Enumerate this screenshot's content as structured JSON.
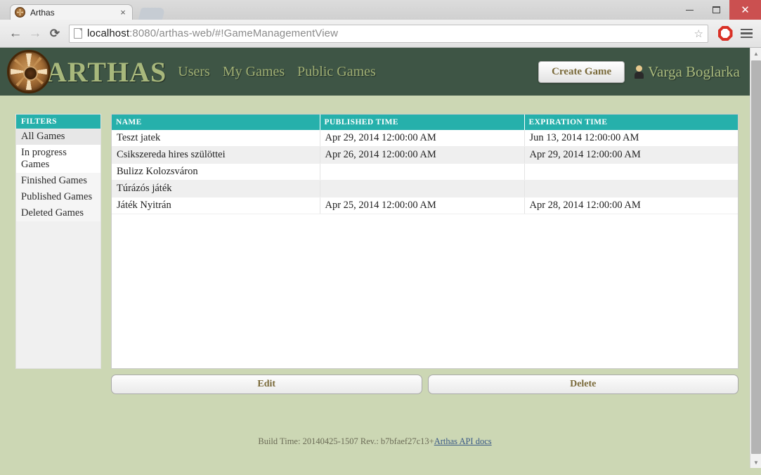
{
  "browser": {
    "tab": {
      "title": "Arthas",
      "favicon": "compass-favicon",
      "close": "×"
    },
    "nav": {
      "back": "←",
      "forward": "→",
      "reload": "⟳"
    },
    "url": {
      "protocol_host": "localhost",
      "rest": ":8080/arthas-web/#!GameManagementView"
    },
    "star": "☆",
    "stop_icon": "✋",
    "window": {
      "minimize": "minimize",
      "maximize": "maximize",
      "close": "✕"
    }
  },
  "header": {
    "logo": "compass-rose-logo",
    "brand": "ARTHAS",
    "nav_links": [
      {
        "label": "Users"
      },
      {
        "label": "My Games"
      },
      {
        "label": "Public Games"
      }
    ],
    "create_game_label": "Create Game",
    "user": {
      "avatar": "user-avatar-icon",
      "name": "Varga Boglarka"
    }
  },
  "filters": {
    "title": "FILTERS",
    "items": [
      {
        "label": "All Games",
        "active": true
      },
      {
        "label": "In progress Games",
        "active": false
      },
      {
        "label": "Finished Games",
        "active": false
      },
      {
        "label": "Published Games",
        "active": false
      },
      {
        "label": "Deleted Games",
        "active": false
      }
    ]
  },
  "table": {
    "columns": [
      "NAME",
      "PUBLISHED TIME",
      "EXPIRATION TIME"
    ],
    "rows": [
      [
        "Teszt jatek",
        "Apr 29, 2014 12:00:00 AM",
        "Jun 13, 2014 12:00:00 AM"
      ],
      [
        "Csikszereda hires szülöttei",
        "Apr 26, 2014 12:00:00 AM",
        "Apr 29, 2014 12:00:00 AM"
      ],
      [
        "Bulizz Kolozsváron",
        "",
        ""
      ],
      [
        "Túrázós játék",
        "",
        ""
      ],
      [
        "Játék Nyitrán",
        "Apr 25, 2014 12:00:00 AM",
        "Apr 28, 2014 12:00:00 AM"
      ]
    ]
  },
  "actions": {
    "edit_label": "Edit",
    "delete_label": "Delete"
  },
  "footer": {
    "build_text": "Build Time: 20140425-1507 Rev.: b7bfaef27c13+",
    "link_label": "Arthas API docs"
  },
  "colors": {
    "header_green": "#3e5545",
    "page_bg": "#ccd7b4",
    "accent_teal": "#26b0ab",
    "brand_olive": "#a8b87c",
    "close_red": "#cb5050"
  }
}
